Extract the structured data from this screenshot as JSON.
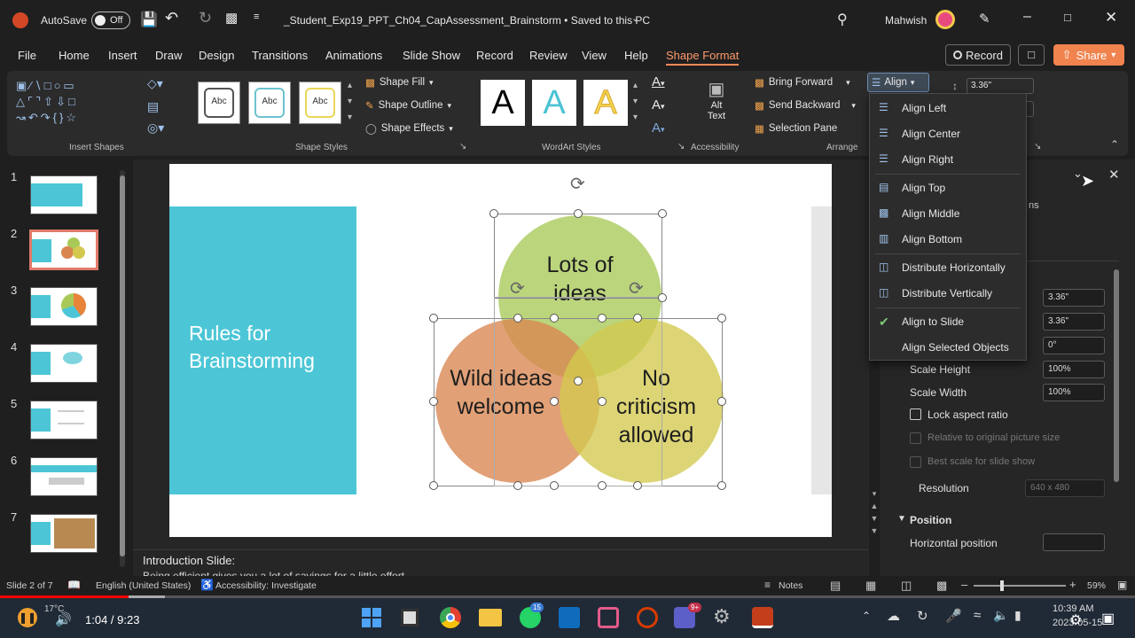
{
  "titlebar": {
    "autosave_label": "AutoSave",
    "autosave_state": "Off",
    "doc_title": "_Student_Exp19_PPT_Ch04_CapAssessment_Brainstorm • Saved to this PC",
    "user_name": "Mahwish"
  },
  "menu": {
    "items": [
      "File",
      "Home",
      "Insert",
      "Draw",
      "Design",
      "Transitions",
      "Animations",
      "Slide Show",
      "Record",
      "Review",
      "View",
      "Help",
      "Shape Format"
    ],
    "record_label": "Record",
    "share_label": "Share"
  },
  "ribbon": {
    "groups": {
      "insert_shapes": "Insert Shapes",
      "shape_styles": "Shape Styles",
      "wordart_styles": "WordArt Styles",
      "accessibility": "Accessibility",
      "arrange": "Arrange"
    },
    "style_sample": "Abc",
    "wordart_sample": "A",
    "shape_fill": "Shape Fill",
    "shape_outline": "Shape Outline",
    "shape_effects": "Shape Effects",
    "alt_text_line1": "Alt",
    "alt_text_line2": "Text",
    "bring_forward": "Bring Forward",
    "send_backward": "Send Backward",
    "selection_pane": "Selection Pane",
    "align": "Align",
    "height_value": "3.36\""
  },
  "align_menu": {
    "items": [
      {
        "label": "Align Left",
        "icon": "align-left-icon"
      },
      {
        "label": "Align Center",
        "icon": "align-center-icon"
      },
      {
        "label": "Align Right",
        "icon": "align-right-icon"
      },
      {
        "label": "Align Top",
        "icon": "align-top-icon"
      },
      {
        "label": "Align Middle",
        "icon": "align-middle-icon"
      },
      {
        "label": "Align Bottom",
        "icon": "align-bottom-icon"
      },
      {
        "label": "Distribute Horizontally",
        "icon": "distribute-horizontally-icon"
      },
      {
        "label": "Distribute Vertically",
        "icon": "distribute-vertically-icon"
      },
      {
        "label": "Align to Slide",
        "icon": "checkmark-icon",
        "checked": true
      },
      {
        "label": "Align Selected Objects",
        "icon": ""
      }
    ]
  },
  "slides": {
    "numbers": [
      "1",
      "2",
      "3",
      "4",
      "5",
      "6",
      "7"
    ],
    "selected": "2"
  },
  "slide": {
    "title": "Rules for Brainstorming",
    "circles": [
      {
        "text": "Lots of ideas",
        "color": "#a8c957"
      },
      {
        "text": "Wild ideas welcome",
        "color": "#d9854f"
      },
      {
        "text": "No criticism allowed",
        "color": "#d4c94e"
      }
    ],
    "accent_color": "#4cc6d6"
  },
  "notes": {
    "heading": "Introduction Slide:",
    "line": "Being efficient gives you a lot of savings for a little effort"
  },
  "format_pane": {
    "partial_text": "ns",
    "fields": {
      "height": "3.36\"",
      "width": "3.36\"",
      "rotation": "0°",
      "scale_height": "100%",
      "scale_width": "100%",
      "resolution": "640 x 480"
    },
    "labels": {
      "scale_height": "Scale Height",
      "scale_width": "Scale Width",
      "lock_aspect": "Lock aspect ratio",
      "relative_original": "Relative to original picture size",
      "best_scale": "Best scale for slide show",
      "resolution": "Resolution",
      "position": "Position",
      "horizontal_position": "Horizontal position"
    }
  },
  "statusbar": {
    "slide_info": "Slide 2 of 7",
    "language": "English (United States)",
    "accessibility": "Accessibility: Investigate",
    "notes": "Notes",
    "zoom": "59%"
  },
  "video": {
    "time": "1:04 / 9:23",
    "progress": 0.113,
    "buffered": 0.145,
    "temperature": "17°C",
    "clock_time": "10:39 AM",
    "clock_date": "2023-05-15",
    "badge_whatsapp": "15",
    "badge_teams": "9+"
  }
}
